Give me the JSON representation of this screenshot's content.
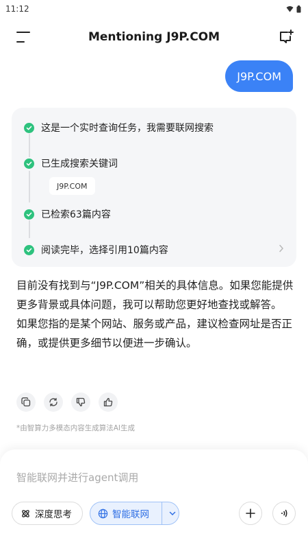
{
  "status_bar": {
    "time": "11:12"
  },
  "header": {
    "title": "Mentioning J9P.COM"
  },
  "conversation": {
    "user_message": "J9P.COM",
    "steps": [
      {
        "label": "这是一个实时查询任务，我需要联网搜索"
      },
      {
        "label": "已生成搜索关键词",
        "keyword": "J9P.COM"
      },
      {
        "label": "已检索63篇内容"
      },
      {
        "label": "阅读完毕，选择引用10篇内容"
      }
    ],
    "answer": [
      "目前没有找到与“J9P.COM”相关的具体信息。如果您能提供更多背景或具体问题，我可以帮助您更好地查找或解答。",
      "如果您指的是某个网站、服务或产品，建议检查网址是否正确，或提供更多细节以便进一步确认。"
    ],
    "disclaimer": "*由智算力多模态内容生成算法AI生成"
  },
  "composer": {
    "placeholder": "智能联网并进行agent调用",
    "deep_think_label": "深度思考",
    "web_search_label": "智能联网"
  },
  "colors": {
    "accent": "#3b82f6",
    "success": "#2ec27e",
    "chip_bg": "#e9f1fe"
  }
}
